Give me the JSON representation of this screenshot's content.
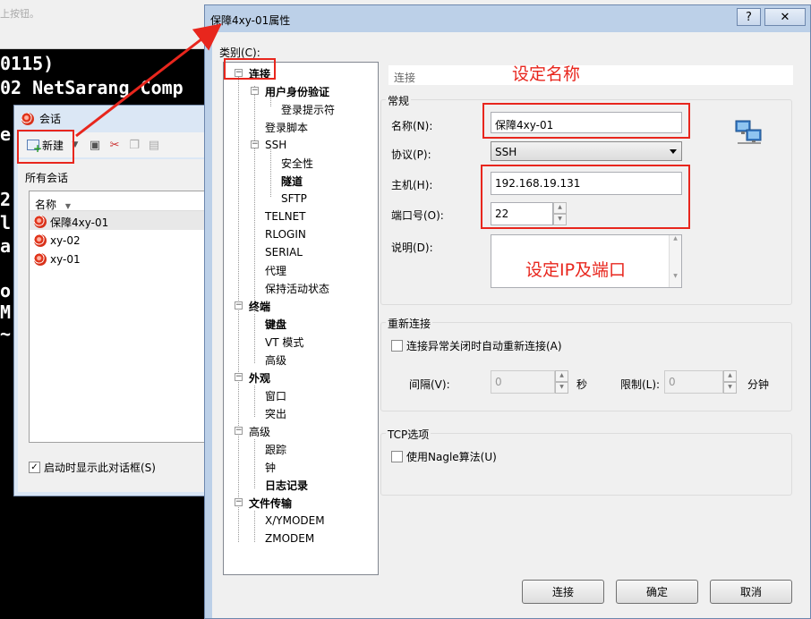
{
  "topbar": {
    "hint": "上按钮。"
  },
  "terminal": {
    "lines": [
      "0115)",
      "02 NetSarang Comp",
      "e",
      "",
      "2",
      "l",
      "a",
      "",
      "o",
      "M",
      "~"
    ]
  },
  "sessions_window": {
    "title": "会话",
    "new_label": "新建",
    "all_sessions": "所有会话",
    "column_name": "名称",
    "items": [
      "保障4xy-01",
      "xy-02",
      "xy-01"
    ],
    "startup_label": "启动时显示此对话框(S)"
  },
  "dialog": {
    "title": "保障4xy-01属性",
    "help_button": "?",
    "close_button": "✕",
    "category_label": "类别(C):",
    "tree": [
      "连接",
      "用户身份验证",
      "登录提示符",
      "登录脚本",
      "SSH",
      "安全性",
      "隧道",
      "SFTP",
      "TELNET",
      "RLOGIN",
      "SERIAL",
      "代理",
      "保持活动状态",
      "终端",
      "键盘",
      "VT 模式",
      "高级",
      "外观",
      "窗口",
      "突出",
      "高级",
      "跟踪",
      "钟",
      "日志记录",
      "文件传输",
      "X/YMODEM",
      "ZMODEM"
    ],
    "page_header": "连接",
    "general": {
      "group_label": "常规",
      "name_label": "名称(N):",
      "name_value": "保障4xy-01",
      "protocol_label": "协议(P):",
      "protocol_value": "SSH",
      "host_label": "主机(H):",
      "host_value": "192.168.19.131",
      "port_label": "端口号(O):",
      "port_value": "22",
      "desc_label": "说明(D):"
    },
    "reconnect": {
      "group_label": "重新连接",
      "checkbox_label": "连接异常关闭时自动重新连接(A)",
      "interval_label": "间隔(V):",
      "interval_value": "0",
      "seconds_unit": "秒",
      "limit_label": "限制(L):",
      "limit_value": "0",
      "minutes_unit": "分钟"
    },
    "tcp": {
      "group_label": "TCP选项",
      "nagle_label": "使用Nagle算法(U)"
    },
    "buttons": {
      "connect": "连接",
      "ok": "确定",
      "cancel": "取消"
    }
  },
  "annotations": {
    "set_name": "设定名称",
    "set_ip_port": "设定IP及端口",
    "color": "#e8261d"
  }
}
